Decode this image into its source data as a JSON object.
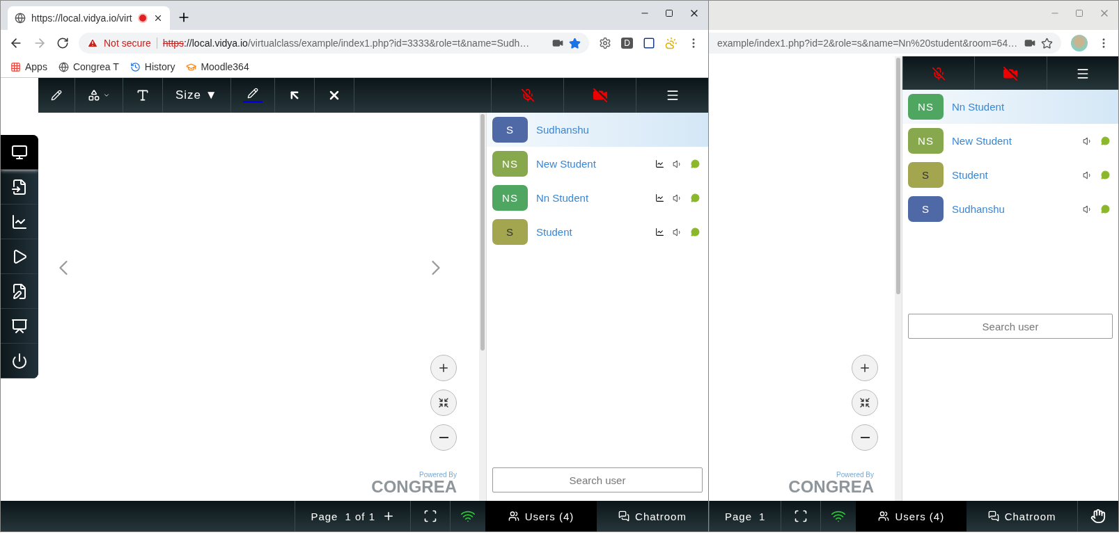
{
  "front_window": {
    "tab": {
      "title": "https://local.vidya.io/virt",
      "selected": true
    },
    "address": {
      "warning": "Not secure",
      "scheme": "https",
      "host": "://local.vidya.io",
      "path": "/virtualclass/example/index1.php?id=3333&role=t&name=Sudh…"
    },
    "extensions": [
      "D"
    ],
    "bookmarks": [
      {
        "label": "Apps",
        "kind": "apps"
      },
      {
        "label": "Congrea T",
        "kind": "globe"
      },
      {
        "label": "History",
        "kind": "history"
      },
      {
        "label": "Moodle364",
        "kind": "moodle"
      }
    ],
    "toolbar": {
      "size_label": "Size ▼"
    },
    "sidebar": [
      {
        "kind": "whiteboard",
        "selected": true
      },
      {
        "kind": "document",
        "selected": false
      },
      {
        "kind": "screen",
        "selected": false
      },
      {
        "kind": "video",
        "selected": false
      },
      {
        "kind": "notes",
        "selected": false
      },
      {
        "kind": "presentation",
        "selected": false
      },
      {
        "kind": "power",
        "selected": false
      }
    ],
    "users": [
      {
        "initials": "S",
        "name": "Sudhanshu",
        "color": "#4f68a6",
        "selected": true
      },
      {
        "initials": "NS",
        "name": "New Student",
        "color": "#88a84e",
        "selected": false,
        "icons": [
          {
            "kind": "screen"
          },
          {
            "kind": "speaker"
          },
          {
            "kind": "chat"
          }
        ]
      },
      {
        "initials": "NS",
        "name": "Nn Student",
        "color": "#4ea661",
        "selected": false,
        "icons": [
          {
            "kind": "screen"
          },
          {
            "kind": "speaker"
          },
          {
            "kind": "chat"
          }
        ]
      },
      {
        "initials": "S",
        "name": "Student",
        "color": "#a3a64f",
        "selected": false,
        "icons": [
          {
            "kind": "screen"
          },
          {
            "kind": "speaker"
          },
          {
            "kind": "chat"
          }
        ]
      }
    ],
    "search_placeholder": "Search user",
    "logo": {
      "caption": "Powered By",
      "brand": "CONGREA"
    },
    "footer": {
      "page_label": "Page",
      "page_value": "1 of 1",
      "add_page": true,
      "tabs": [
        {
          "label": "Users (4)",
          "selected": true
        },
        {
          "label": "Chatroom",
          "selected": false
        }
      ]
    }
  },
  "back_window": {
    "address": {
      "path": "example/index1.php?id=2&role=s&name=Nn%20student&room=64…"
    },
    "users": [
      {
        "initials": "NS",
        "name": "Nn Student",
        "color": "#4ea661",
        "selected": true
      },
      {
        "initials": "NS",
        "name": "New Student",
        "color": "#88a84e",
        "selected": false,
        "icons": [
          {
            "kind": "speaker"
          },
          {
            "kind": "chat"
          }
        ]
      },
      {
        "initials": "S",
        "name": "Student",
        "color": "#a3a64f",
        "selected": false,
        "icons": [
          {
            "kind": "speaker"
          },
          {
            "kind": "chat"
          }
        ]
      },
      {
        "initials": "S",
        "name": "Sudhanshu",
        "color": "#4f68a6",
        "selected": false,
        "icons": [
          {
            "kind": "speaker"
          },
          {
            "kind": "chat"
          }
        ]
      }
    ],
    "search_placeholder": "Search user",
    "logo": {
      "caption": "Powered By",
      "brand": "CONGREA"
    },
    "footer": {
      "page_label": "Page",
      "page_value": "1",
      "hand_button": true,
      "tabs": [
        {
          "label": "Users (4)",
          "selected": true
        },
        {
          "label": "Chatroom",
          "selected": false
        }
      ]
    }
  }
}
